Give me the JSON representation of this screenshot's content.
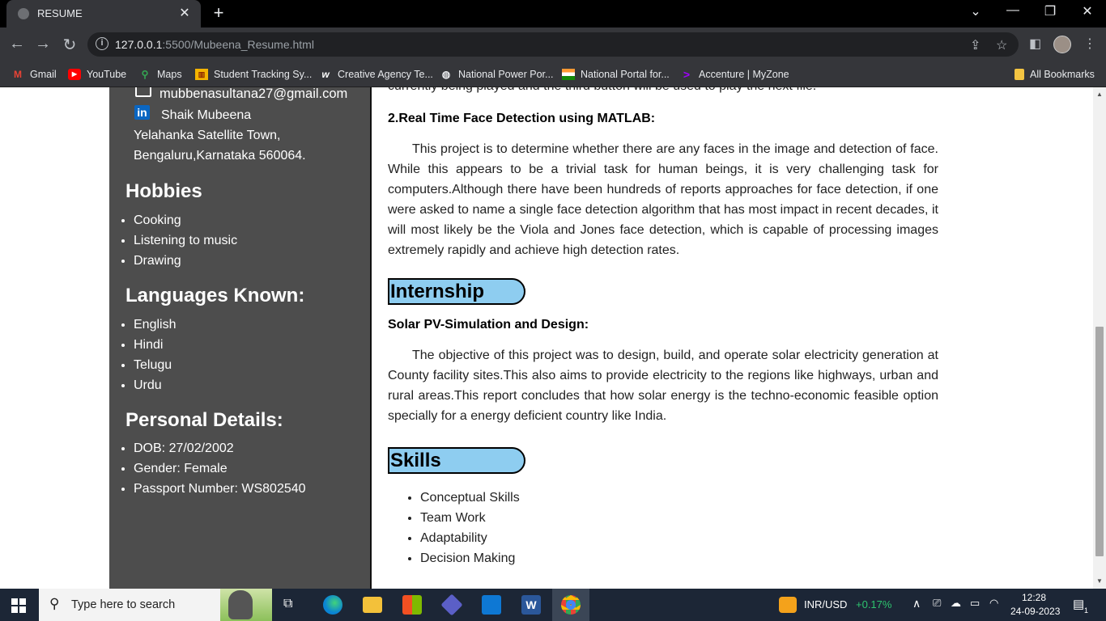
{
  "browser": {
    "tab_title": "RESUME",
    "tab_close": "✕",
    "new_tab": "+",
    "url_host": "127.0.0.1",
    "url_path": ":5500/Mubeena_Resume.html",
    "bookmarks": [
      {
        "label": "Gmail",
        "icon": "gmail-icon"
      },
      {
        "label": "YouTube",
        "icon": "youtube-icon"
      },
      {
        "label": "Maps",
        "icon": "maps-icon"
      },
      {
        "label": "Student Tracking Sy...",
        "icon": "chart-icon"
      },
      {
        "label": "Creative Agency Te...",
        "icon": "w-logo-icon"
      },
      {
        "label": "National Power Por...",
        "icon": "globe-icon"
      },
      {
        "label": "National Portal for...",
        "icon": "flag-icon"
      },
      {
        "label": "Accenture | MyZone",
        "icon": "accenture-icon"
      }
    ],
    "all_bookmarks": "All Bookmarks"
  },
  "sidebar": {
    "email": "mubbenasultana27@gmail.com",
    "linkedin": "Shaik Mubeena",
    "address_line1": "Yelahanka Satellite Town,",
    "address_line2": "Bengaluru,Karnataka 560064.",
    "hobbies_title": "Hobbies",
    "hobbies": [
      "Cooking",
      "Listening to music",
      "Drawing"
    ],
    "languages_title": "Languages Known:",
    "languages": [
      "English",
      "Hindi",
      "Telugu",
      "Urdu"
    ],
    "personal_title": "Personal Details:",
    "personal": [
      "DOB: 27/02/2002",
      "Gender: Female",
      "Passport Number: WS802540"
    ]
  },
  "main": {
    "cut_line": "currently being played and the third button will be used to play the next file.",
    "project2_title": "2.Real Time Face Detection using MATLAB:",
    "project2_desc": "This project is to determine whether there are any faces in the image and detection of face. While this appears to be a trivial task for human beings, it is very challenging task for computers.Although there have been hundreds of reports approaches for face detection, if one were asked to name a single face detection algorithm that has most impact in recent decades, it will most likely be the Viola and Jones face detection, which is capable of processing images extremely rapidly and achieve high detection rates.",
    "internship_title": "Internship",
    "internship_subtitle": "Solar PV-Simulation and Design:",
    "internship_desc": "The objective of this project was to design, build, and operate solar electricity generation at County facility sites.This also aims to provide electricity to the regions like highways, urban and rural areas.This report concludes that how solar energy is the techno-economic feasible option specially for a energy deficient country like India.",
    "skills_title": "Skills",
    "skills": [
      "Conceptual Skills",
      "Team Work",
      "Adaptability",
      "Decision Making"
    ]
  },
  "taskbar": {
    "search_placeholder": "Type here to search",
    "currency_label": "INR/USD",
    "currency_change": "+0.17%",
    "time": "12:28",
    "date": "24-09-2023",
    "notification_count": "1"
  },
  "colors": {
    "sidebar_bg": "#4d4d4d",
    "section_pill": "#8ecdf0",
    "currency_up": "#2ec46f"
  }
}
